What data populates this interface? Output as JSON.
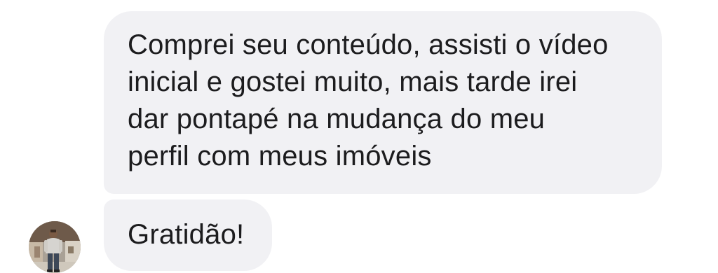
{
  "conversation": {
    "messages": [
      {
        "lines": [
          "Comprei seu conteúdo, assisti o vídeo",
          "inicial e gostei muito, mais tarde irei",
          "dar pontapé na mudança do meu",
          "perfil com meus imóveis"
        ]
      },
      {
        "lines": [
          "Gratidão!"
        ]
      }
    ],
    "sender": {
      "avatar_icon": "person-photo-icon"
    }
  },
  "colors": {
    "bubble_background": "#f1f1f4",
    "text": "#1c1c1e",
    "page_background": "#ffffff"
  }
}
